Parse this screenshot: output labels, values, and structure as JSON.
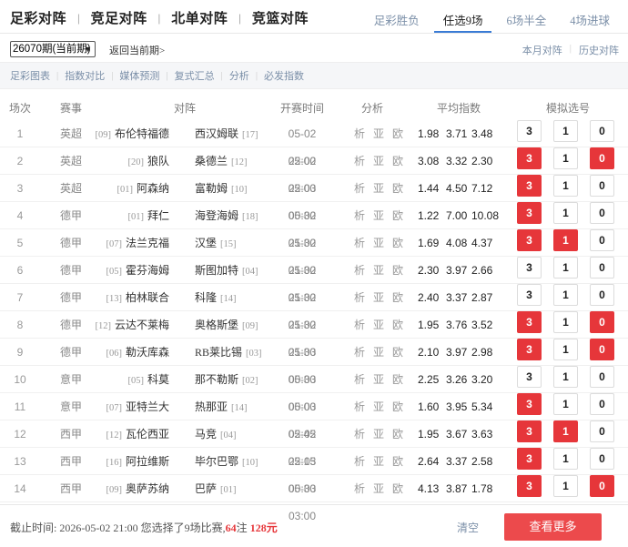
{
  "top_nav": {
    "left": [
      "足彩对阵",
      "竞足对阵",
      "北单对阵",
      "竞篮对阵"
    ],
    "right_tabs": [
      "足彩胜负",
      "任选9场",
      "6场半全",
      "4场进球"
    ],
    "active_tab": "任选9场"
  },
  "issue": {
    "selected": "26070期(当前期)",
    "back_link": "返回当前期>",
    "right_links": [
      "本月对阵",
      "历史对阵"
    ]
  },
  "subnav": [
    "足彩图表",
    "指数对比",
    "媒体预测",
    "复式汇总",
    "分析",
    "必发指数"
  ],
  "table": {
    "headers": {
      "index": "场次",
      "league": "赛事",
      "match": "对阵",
      "time": "开赛时间",
      "analysis": "分析",
      "odds": "平均指数",
      "pick": "模拟选号"
    },
    "analysis_label": "析 亚 欧",
    "pick_labels": [
      "3",
      "1",
      "0"
    ],
    "rows": [
      {
        "idx": "1",
        "league": "英超",
        "home_rank": "[09]",
        "home": "布伦特福德",
        "away": "西汉姆联",
        "away_rank": "[17]",
        "time": "05-02 22:00",
        "o1": "1.98",
        "o2": "3.71",
        "o3": "3.48",
        "selected": []
      },
      {
        "idx": "2",
        "league": "英超",
        "home_rank": "[20]",
        "home": "狼队",
        "away": "桑德兰",
        "away_rank": "[12]",
        "time": "05-02 22:00",
        "o1": "3.08",
        "o2": "3.32",
        "o3": "2.30",
        "selected": [
          "3",
          "0"
        ]
      },
      {
        "idx": "3",
        "league": "英超",
        "home_rank": "[01]",
        "home": "阿森纳",
        "away": "富勒姆",
        "away_rank": "[10]",
        "time": "05-03 00:30",
        "o1": "1.44",
        "o2": "4.50",
        "o3": "7.12",
        "selected": [
          "3"
        ]
      },
      {
        "idx": "4",
        "league": "德甲",
        "home_rank": "[01]",
        "home": "拜仁",
        "away": "海登海姆",
        "away_rank": "[18]",
        "time": "05-02 21:30",
        "o1": "1.22",
        "o2": "7.00",
        "o3": "10.08",
        "selected": [
          "3"
        ]
      },
      {
        "idx": "5",
        "league": "德甲",
        "home_rank": "[07]",
        "home": "法兰克福",
        "away": "汉堡",
        "away_rank": "[15]",
        "time": "05-02 21:30",
        "o1": "1.69",
        "o2": "4.08",
        "o3": "4.37",
        "selected": [
          "3",
          "1"
        ]
      },
      {
        "idx": "6",
        "league": "德甲",
        "home_rank": "[05]",
        "home": "霍芬海姆",
        "away": "斯图加特",
        "away_rank": "[04]",
        "time": "05-02 21:30",
        "o1": "2.30",
        "o2": "3.97",
        "o3": "2.66",
        "selected": []
      },
      {
        "idx": "7",
        "league": "德甲",
        "home_rank": "[13]",
        "home": "柏林联合",
        "away": "科隆",
        "away_rank": "[14]",
        "time": "05-02 21:30",
        "o1": "2.40",
        "o2": "3.37",
        "o3": "2.87",
        "selected": []
      },
      {
        "idx": "8",
        "league": "德甲",
        "home_rank": "[12]",
        "home": "云达不莱梅",
        "away": "奥格斯堡",
        "away_rank": "[09]",
        "time": "05-02 21:30",
        "o1": "1.95",
        "o2": "3.76",
        "o3": "3.52",
        "selected": [
          "3",
          "0"
        ]
      },
      {
        "idx": "9",
        "league": "德甲",
        "home_rank": "[06]",
        "home": "勒沃库森",
        "away": "RB莱比锡",
        "away_rank": "[03]",
        "time": "05-03 00:30",
        "o1": "2.10",
        "o2": "3.97",
        "o3": "2.98",
        "selected": [
          "3",
          "0"
        ]
      },
      {
        "idx": "10",
        "league": "意甲",
        "home_rank": "[05]",
        "home": "科莫",
        "away": "那不勒斯",
        "away_rank": "[02]",
        "time": "05-03 00:00",
        "o1": "2.25",
        "o2": "3.26",
        "o3": "3.20",
        "selected": []
      },
      {
        "idx": "11",
        "league": "意甲",
        "home_rank": "[07]",
        "home": "亚特兰大",
        "away": "热那亚",
        "away_rank": "[14]",
        "time": "05-03 02:45",
        "o1": "1.60",
        "o2": "3.95",
        "o3": "5.34",
        "selected": [
          "3"
        ]
      },
      {
        "idx": "12",
        "league": "西甲",
        "home_rank": "[12]",
        "home": "瓦伦西亚",
        "away": "马竞",
        "away_rank": "[04]",
        "time": "05-02 22:15",
        "o1": "1.95",
        "o2": "3.67",
        "o3": "3.63",
        "selected": [
          "3",
          "1"
        ]
      },
      {
        "idx": "13",
        "league": "西甲",
        "home_rank": "[16]",
        "home": "阿拉维斯",
        "away": "毕尔巴鄂",
        "away_rank": "[10]",
        "time": "05-03 00:30",
        "o1": "2.64",
        "o2": "3.37",
        "o3": "2.58",
        "selected": [
          "3"
        ]
      },
      {
        "idx": "14",
        "league": "西甲",
        "home_rank": "[09]",
        "home": "奥萨苏纳",
        "away": "巴萨",
        "away_rank": "[01]",
        "time": "05-03 03:00",
        "o1": "4.13",
        "o2": "3.87",
        "o3": "1.78",
        "selected": [
          "3",
          "0"
        ]
      }
    ]
  },
  "footer": {
    "prefix": "截止时间: 2026-05-02 21:00 您选择了9场比赛,",
    "bets": "64",
    "bets_unit": "注",
    "amount": "128元",
    "clear_label": "清空",
    "more_label": "查看更多"
  },
  "colors": {
    "accent_red": "#e6363a",
    "button_red": "#ec4a4c",
    "tab_underline": "#3a7bd5",
    "link_gray_blue": "#7b8fa8"
  }
}
